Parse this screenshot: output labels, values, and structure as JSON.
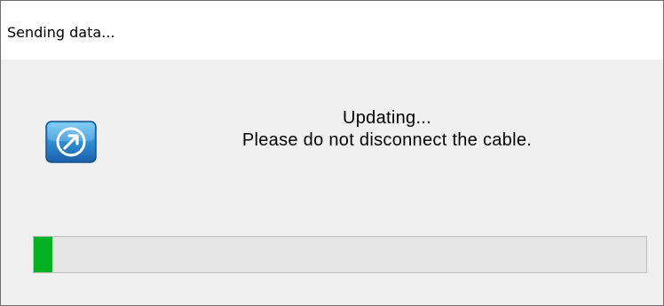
{
  "window": {
    "title": "Sending data..."
  },
  "dialog": {
    "icon": "update-arrow-icon",
    "message_line1": "Updating...",
    "message_line2": "Please do not disconnect the cable."
  },
  "progress": {
    "fraction": 0.03,
    "color": "#06b025"
  }
}
